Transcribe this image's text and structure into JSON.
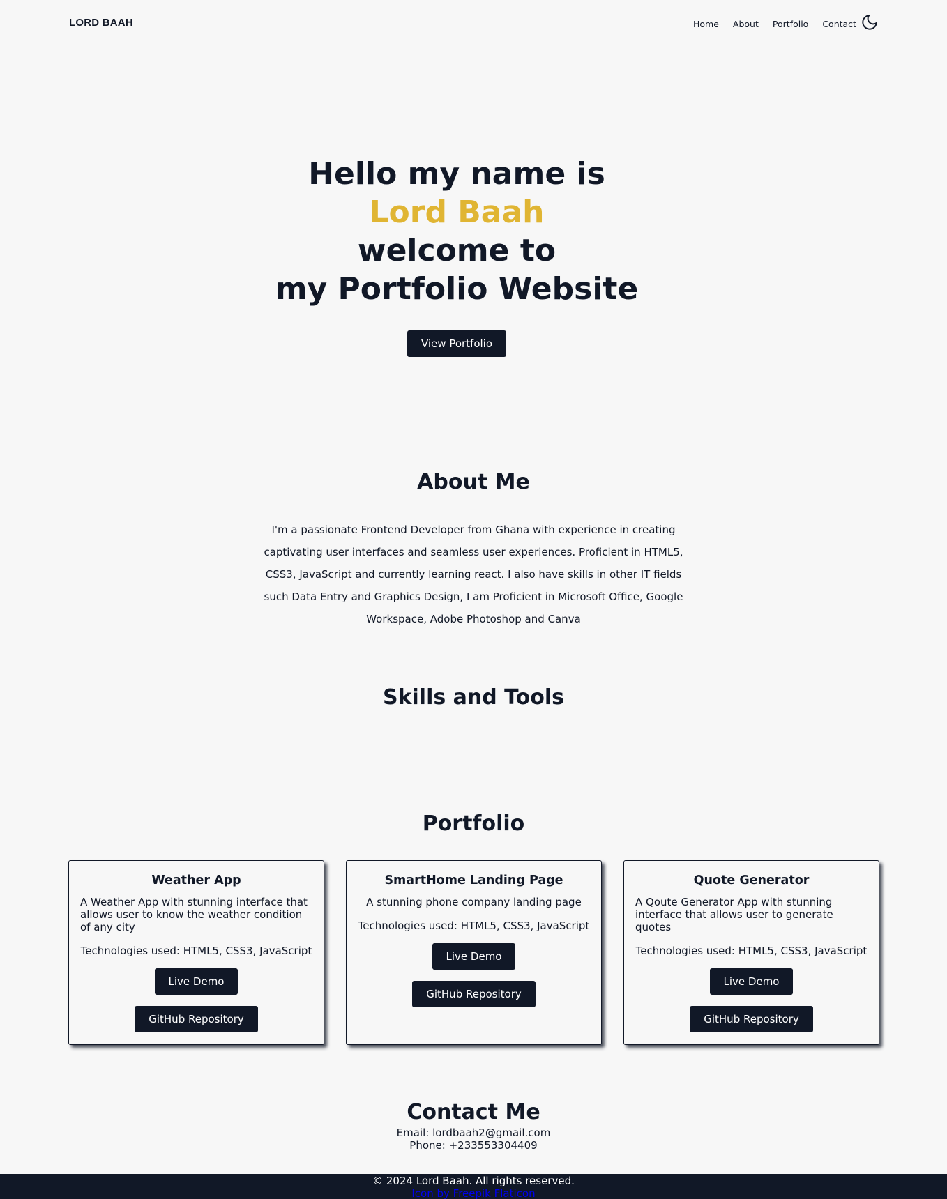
{
  "header": {
    "brand": "LORD BAAH",
    "nav": [
      "Home",
      "About",
      "Portfolio",
      "Contact"
    ],
    "theme_toggle_icon": "moon-icon"
  },
  "hero": {
    "line1": "Hello my name is",
    "name": "Lord Baah",
    "line3": "welcome to",
    "line4": "my Portfolio Website",
    "button": "View Portfolio",
    "accent_color": "#e0b533"
  },
  "about": {
    "title": "About Me",
    "text": "I'm a passionate Frontend Developer from Ghana with experience in creating captivating user interfaces and seamless user experiences. Proficient in HTML5, CSS3, JavaScript and currently learning react. I also have skills in other IT fields such Data Entry and Graphics Design, I am Proficient in Microsoft Office, Google Workspace, Adobe Photoshop and Canva"
  },
  "skills": {
    "title": "Skills and Tools"
  },
  "portfolio": {
    "title": "Portfolio",
    "projects": [
      {
        "title": "Weather App",
        "description": "A Weather App with stunning interface that allows user to know the weather condition of any city",
        "tech": "Technologies used: HTML5, CSS3, JavaScript",
        "demo": "Live Demo",
        "repo": "GitHub Repository"
      },
      {
        "title": "SmartHome Landing Page",
        "description": "A stunning phone company landing page",
        "tech": "Technologies used: HTML5, CSS3, JavaScript",
        "demo": "Live Demo",
        "repo": "GitHub Repository"
      },
      {
        "title": "Quote Generator",
        "description": "A Qoute Generator App with stunning interface that allows user to generate quotes",
        "tech": "Technologies used: HTML5, CSS3, JavaScript",
        "demo": "Live Demo",
        "repo": "GitHub Repository"
      }
    ]
  },
  "contact": {
    "title": "Contact Me",
    "email": "Email: lordbaah2@gmail.com",
    "phone": "Phone: +233553304409"
  },
  "footer": {
    "copyright": "© 2024 Lord Baah. All rights reserved.",
    "credit": "Icon by Freepik Flaticon"
  },
  "colors": {
    "primary": "#111827",
    "background": "#f7f7f7",
    "accent": "#e0b533"
  }
}
